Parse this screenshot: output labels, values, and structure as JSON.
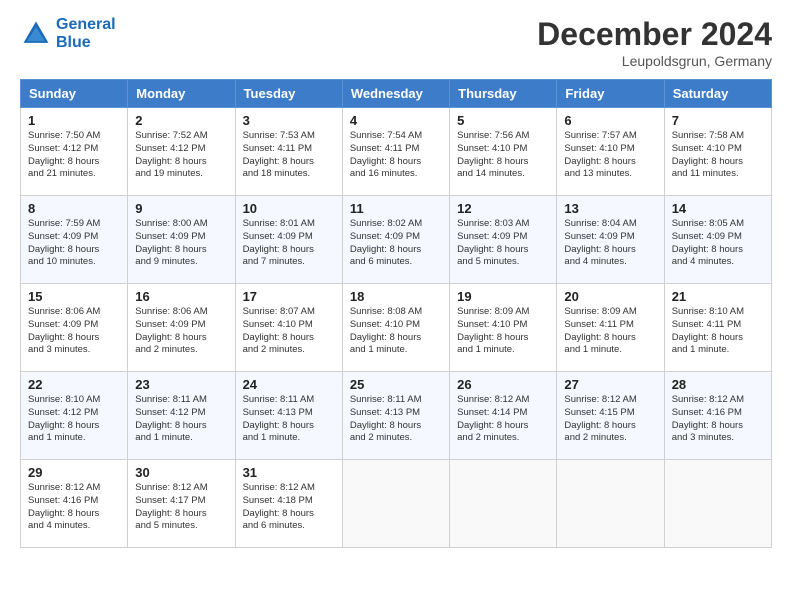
{
  "header": {
    "logo_line1": "General",
    "logo_line2": "Blue",
    "month": "December 2024",
    "location": "Leupoldsgrun, Germany"
  },
  "days_of_week": [
    "Sunday",
    "Monday",
    "Tuesday",
    "Wednesday",
    "Thursday",
    "Friday",
    "Saturday"
  ],
  "weeks": [
    [
      {
        "day": 1,
        "lines": [
          "Sunrise: 7:50 AM",
          "Sunset: 4:12 PM",
          "Daylight: 8 hours",
          "and 21 minutes."
        ]
      },
      {
        "day": 2,
        "lines": [
          "Sunrise: 7:52 AM",
          "Sunset: 4:12 PM",
          "Daylight: 8 hours",
          "and 19 minutes."
        ]
      },
      {
        "day": 3,
        "lines": [
          "Sunrise: 7:53 AM",
          "Sunset: 4:11 PM",
          "Daylight: 8 hours",
          "and 18 minutes."
        ]
      },
      {
        "day": 4,
        "lines": [
          "Sunrise: 7:54 AM",
          "Sunset: 4:11 PM",
          "Daylight: 8 hours",
          "and 16 minutes."
        ]
      },
      {
        "day": 5,
        "lines": [
          "Sunrise: 7:56 AM",
          "Sunset: 4:10 PM",
          "Daylight: 8 hours",
          "and 14 minutes."
        ]
      },
      {
        "day": 6,
        "lines": [
          "Sunrise: 7:57 AM",
          "Sunset: 4:10 PM",
          "Daylight: 8 hours",
          "and 13 minutes."
        ]
      },
      {
        "day": 7,
        "lines": [
          "Sunrise: 7:58 AM",
          "Sunset: 4:10 PM",
          "Daylight: 8 hours",
          "and 11 minutes."
        ]
      }
    ],
    [
      {
        "day": 8,
        "lines": [
          "Sunrise: 7:59 AM",
          "Sunset: 4:09 PM",
          "Daylight: 8 hours",
          "and 10 minutes."
        ]
      },
      {
        "day": 9,
        "lines": [
          "Sunrise: 8:00 AM",
          "Sunset: 4:09 PM",
          "Daylight: 8 hours",
          "and 9 minutes."
        ]
      },
      {
        "day": 10,
        "lines": [
          "Sunrise: 8:01 AM",
          "Sunset: 4:09 PM",
          "Daylight: 8 hours",
          "and 7 minutes."
        ]
      },
      {
        "day": 11,
        "lines": [
          "Sunrise: 8:02 AM",
          "Sunset: 4:09 PM",
          "Daylight: 8 hours",
          "and 6 minutes."
        ]
      },
      {
        "day": 12,
        "lines": [
          "Sunrise: 8:03 AM",
          "Sunset: 4:09 PM",
          "Daylight: 8 hours",
          "and 5 minutes."
        ]
      },
      {
        "day": 13,
        "lines": [
          "Sunrise: 8:04 AM",
          "Sunset: 4:09 PM",
          "Daylight: 8 hours",
          "and 4 minutes."
        ]
      },
      {
        "day": 14,
        "lines": [
          "Sunrise: 8:05 AM",
          "Sunset: 4:09 PM",
          "Daylight: 8 hours",
          "and 4 minutes."
        ]
      }
    ],
    [
      {
        "day": 15,
        "lines": [
          "Sunrise: 8:06 AM",
          "Sunset: 4:09 PM",
          "Daylight: 8 hours",
          "and 3 minutes."
        ]
      },
      {
        "day": 16,
        "lines": [
          "Sunrise: 8:06 AM",
          "Sunset: 4:09 PM",
          "Daylight: 8 hours",
          "and 2 minutes."
        ]
      },
      {
        "day": 17,
        "lines": [
          "Sunrise: 8:07 AM",
          "Sunset: 4:10 PM",
          "Daylight: 8 hours",
          "and 2 minutes."
        ]
      },
      {
        "day": 18,
        "lines": [
          "Sunrise: 8:08 AM",
          "Sunset: 4:10 PM",
          "Daylight: 8 hours",
          "and 1 minute."
        ]
      },
      {
        "day": 19,
        "lines": [
          "Sunrise: 8:09 AM",
          "Sunset: 4:10 PM",
          "Daylight: 8 hours",
          "and 1 minute."
        ]
      },
      {
        "day": 20,
        "lines": [
          "Sunrise: 8:09 AM",
          "Sunset: 4:11 PM",
          "Daylight: 8 hours",
          "and 1 minute."
        ]
      },
      {
        "day": 21,
        "lines": [
          "Sunrise: 8:10 AM",
          "Sunset: 4:11 PM",
          "Daylight: 8 hours",
          "and 1 minute."
        ]
      }
    ],
    [
      {
        "day": 22,
        "lines": [
          "Sunrise: 8:10 AM",
          "Sunset: 4:12 PM",
          "Daylight: 8 hours",
          "and 1 minute."
        ]
      },
      {
        "day": 23,
        "lines": [
          "Sunrise: 8:11 AM",
          "Sunset: 4:12 PM",
          "Daylight: 8 hours",
          "and 1 minute."
        ]
      },
      {
        "day": 24,
        "lines": [
          "Sunrise: 8:11 AM",
          "Sunset: 4:13 PM",
          "Daylight: 8 hours",
          "and 1 minute."
        ]
      },
      {
        "day": 25,
        "lines": [
          "Sunrise: 8:11 AM",
          "Sunset: 4:13 PM",
          "Daylight: 8 hours",
          "and 2 minutes."
        ]
      },
      {
        "day": 26,
        "lines": [
          "Sunrise: 8:12 AM",
          "Sunset: 4:14 PM",
          "Daylight: 8 hours",
          "and 2 minutes."
        ]
      },
      {
        "day": 27,
        "lines": [
          "Sunrise: 8:12 AM",
          "Sunset: 4:15 PM",
          "Daylight: 8 hours",
          "and 2 minutes."
        ]
      },
      {
        "day": 28,
        "lines": [
          "Sunrise: 8:12 AM",
          "Sunset: 4:16 PM",
          "Daylight: 8 hours",
          "and 3 minutes."
        ]
      }
    ],
    [
      {
        "day": 29,
        "lines": [
          "Sunrise: 8:12 AM",
          "Sunset: 4:16 PM",
          "Daylight: 8 hours",
          "and 4 minutes."
        ]
      },
      {
        "day": 30,
        "lines": [
          "Sunrise: 8:12 AM",
          "Sunset: 4:17 PM",
          "Daylight: 8 hours",
          "and 5 minutes."
        ]
      },
      {
        "day": 31,
        "lines": [
          "Sunrise: 8:12 AM",
          "Sunset: 4:18 PM",
          "Daylight: 8 hours",
          "and 6 minutes."
        ]
      },
      null,
      null,
      null,
      null
    ]
  ]
}
